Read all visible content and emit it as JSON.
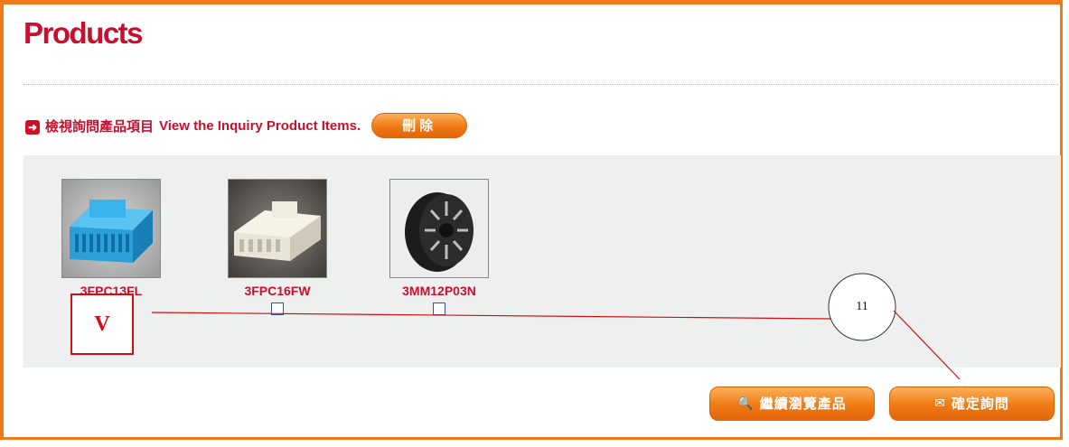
{
  "page": {
    "title": "Products"
  },
  "inquiry": {
    "heading_zh": "檢視詢問產品項目",
    "heading_en": "View the Inquiry Product Items.",
    "delete_label": "刪除"
  },
  "products": [
    {
      "name": "3FPC13FL",
      "image": "blue-connector"
    },
    {
      "name": "3FPC16FW",
      "image": "white-connector"
    },
    {
      "name": "3MM12P03N",
      "image": "black-reel"
    }
  ],
  "annotations": {
    "box_label": "V",
    "circle_label": "11"
  },
  "actions": {
    "continue_label": "繼續瀏覽產品",
    "confirm_label": "確定詢問",
    "continue_icon": "zoom-icon",
    "confirm_icon": "envelope-icon"
  },
  "colors": {
    "accent": "#f07a1a",
    "brand_red": "#c8102e",
    "annotation_red": "#d01010"
  }
}
